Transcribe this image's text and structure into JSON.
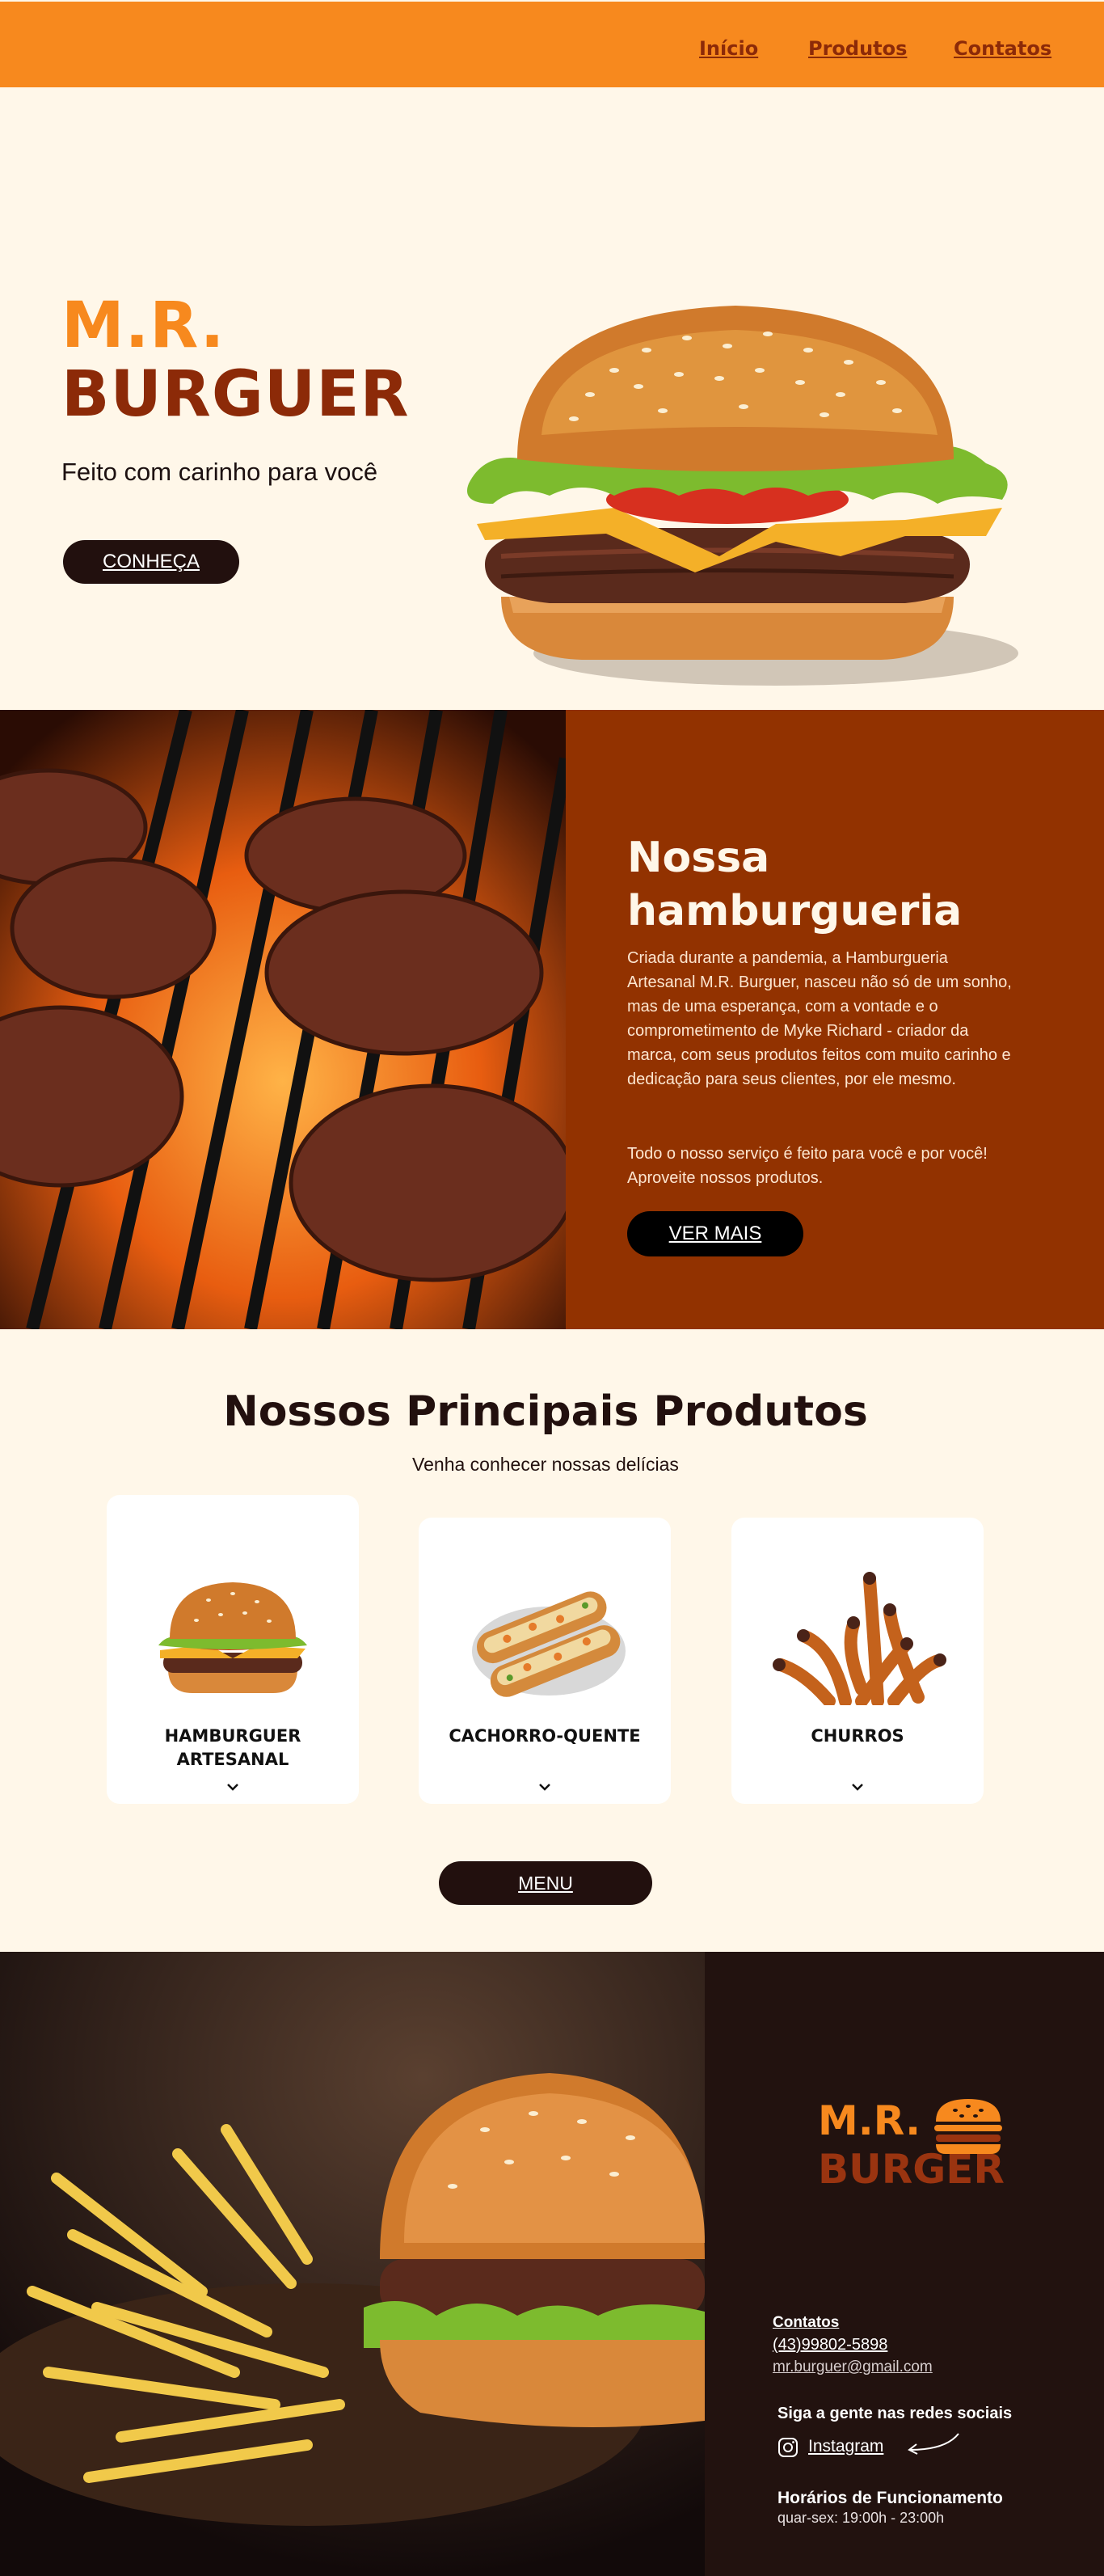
{
  "nav": {
    "items": [
      {
        "label": "Início"
      },
      {
        "label": "Produtos"
      },
      {
        "label": "Contatos"
      }
    ]
  },
  "hero": {
    "brand_line1": "M.R.",
    "brand_line2": "BURGUER",
    "tagline": "Feito com carinho para você",
    "cta_label": "CONHEÇA"
  },
  "about": {
    "title_line1": "Nossa",
    "title_line2": "hamburgueria",
    "paragraph1": "Criada durante a pandemia, a Hamburgueria Artesanal M.R. Burguer, nasceu não só de um sonho, mas de uma esperança, com  a vontade e o comprometimento de Myke Richard - criador da marca, com seus produtos feitos com muito carinho e dedicação para seus clientes, por ele mesmo.",
    "paragraph2": "Todo o nosso serviço é feito para você e por você! Aproveite nossos produtos.",
    "cta_label": "VER MAIS"
  },
  "products": {
    "title": "Nossos Principais Produtos",
    "subtitle": "Venha conhecer nossas delícias",
    "items": [
      {
        "label_line1": "HAMBURGUER",
        "label_line2": "ARTESANAL",
        "icon": "burger-icon"
      },
      {
        "label_line1": "CACHORRO-QUENTE",
        "label_line2": "",
        "icon": "hotdog-icon"
      },
      {
        "label_line1": "CHURROS",
        "label_line2": "",
        "icon": "churros-icon"
      }
    ],
    "menu_label": "MENU"
  },
  "footer": {
    "logo_line1": "M.R.",
    "logo_line2": "BURGER",
    "contacts_heading": "Contatos ",
    "phone": "(43)99802-5898",
    "email": "mr.burguer@gmail.com",
    "social_heading": "Siga a gente nas redes sociais",
    "instagram_label": "Instagram",
    "hours_heading": "Horários de Funcionamento",
    "hours_value": "quar-sex: 19:00h - 23:00h"
  },
  "colors": {
    "accent_orange": "#f7891e",
    "brand_brown": "#8c2a08",
    "panel_rust": "#923200",
    "cream": "#fff7e9",
    "dark": "#22100e"
  }
}
